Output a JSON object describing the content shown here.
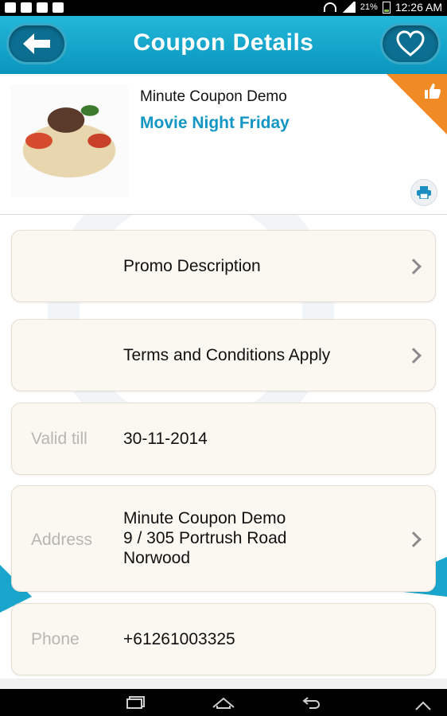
{
  "status_bar": {
    "battery_percent": "21%",
    "time": "12:26 AM"
  },
  "header": {
    "title": "Coupon Details",
    "back_icon": "arrow-left-icon",
    "favorite_icon": "heart-outline-icon"
  },
  "coupon": {
    "merchant_name": "Minute Coupon Demo",
    "title": "Movie Night Friday",
    "image_icon": "food-photo",
    "ribbon_icon": "thumbs-up-icon",
    "print_icon": "printer-icon"
  },
  "rows": [
    {
      "label": "",
      "value": "Promo Description",
      "has_chevron": true
    },
    {
      "label": "",
      "value": "Terms and Conditions Apply",
      "has_chevron": true
    },
    {
      "label": "Valid till",
      "value": "30-11-2014",
      "has_chevron": false
    },
    {
      "label": "Address",
      "value_lines": [
        "Minute Coupon Demo",
        "9 / 305 Portrush Road",
        "Norwood"
      ],
      "has_chevron": true
    },
    {
      "label": "Phone",
      "value": "+61261003325",
      "has_chevron": false
    }
  ],
  "colors": {
    "header": "#0a95bd",
    "title_accent": "#1296c4",
    "ribbon": "#f08a24",
    "row_bg": "#fbf7f1"
  }
}
